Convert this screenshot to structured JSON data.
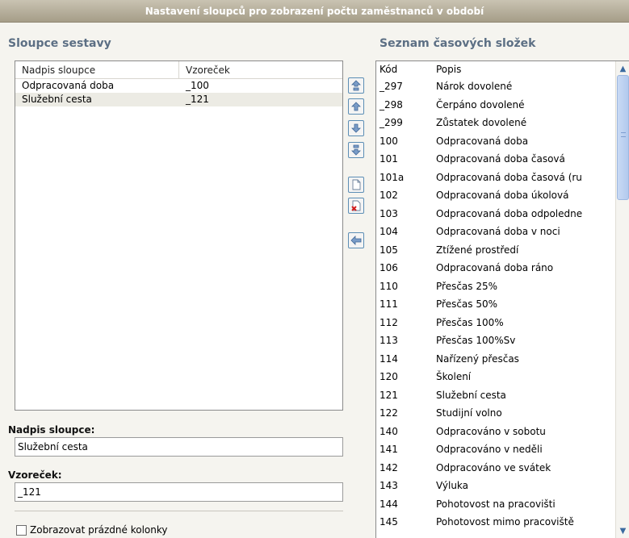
{
  "window": {
    "title": "Nastavení sloupců pro zobrazení počtu zaměstnanců v období"
  },
  "left_panel": {
    "title": "Sloupce sestavy",
    "columns": [
      "Nadpis sloupce",
      "Vzoreček"
    ],
    "rows": [
      {
        "label": "Odpracovaná doba",
        "formula": "_100",
        "selected": false
      },
      {
        "label": "Služební cesta",
        "formula": "_121",
        "selected": true
      }
    ]
  },
  "middle_buttons": [
    {
      "name": "move-top-button",
      "icon": "double-up-arrow"
    },
    {
      "name": "move-up-button",
      "icon": "up-arrow"
    },
    {
      "name": "move-down-button",
      "icon": "down-arrow"
    },
    {
      "name": "move-bottom-button",
      "icon": "double-down-arrow"
    },
    {
      "name": "new-column-button",
      "icon": "new-page"
    },
    {
      "name": "delete-column-button",
      "icon": "delete-page"
    },
    {
      "name": "add-from-list-button",
      "icon": "left-arrow"
    }
  ],
  "form": {
    "column_title_label": "Nadpis sloupce:",
    "column_title_value": "Služební cesta",
    "formula_label": "Vzoreček:",
    "formula_value": "_121",
    "show_empty_label": "Zobrazovat prázdné kolonky",
    "show_empty_checked": false
  },
  "right_panel": {
    "title": "Seznam časových složek",
    "columns": [
      "Kód",
      "Popis"
    ],
    "rows": [
      {
        "code": "_297",
        "desc": "Nárok dovolené"
      },
      {
        "code": "_298",
        "desc": "Čerpáno dovolené"
      },
      {
        "code": "_299",
        "desc": "Zůstatek dovolené"
      },
      {
        "code": "100",
        "desc": "Odpracovaná doba"
      },
      {
        "code": "101",
        "desc": "Odpracovaná doba časová"
      },
      {
        "code": "101a",
        "desc": "Odpracovaná doba časová (ru"
      },
      {
        "code": "102",
        "desc": "Odpracovaná doba úkolová"
      },
      {
        "code": "103",
        "desc": "Odpracovaná doba odpoledne"
      },
      {
        "code": "104",
        "desc": "Odpracovaná doba v noci"
      },
      {
        "code": "105",
        "desc": "Ztížené prostředí"
      },
      {
        "code": "106",
        "desc": "Odpracovaná doba ráno"
      },
      {
        "code": "110",
        "desc": "Přesčas 25%"
      },
      {
        "code": "111",
        "desc": "Přesčas 50%"
      },
      {
        "code": "112",
        "desc": "Přesčas 100%"
      },
      {
        "code": "113",
        "desc": "Přesčas 100%Sv"
      },
      {
        "code": "114",
        "desc": "Nařízený přesčas"
      },
      {
        "code": "120",
        "desc": "Školení"
      },
      {
        "code": "121",
        "desc": "Služební cesta"
      },
      {
        "code": "122",
        "desc": "Studijní volno"
      },
      {
        "code": "140",
        "desc": "Odpracováno v sobotu"
      },
      {
        "code": "141",
        "desc": "Odpracováno v neděli"
      },
      {
        "code": "142",
        "desc": "Odpracováno ve svátek"
      },
      {
        "code": "143",
        "desc": "Výluka"
      },
      {
        "code": "144",
        "desc": "Pohotovost na pracovišti"
      },
      {
        "code": "145",
        "desc": "Pohotovost mimo pracoviště"
      }
    ]
  }
}
